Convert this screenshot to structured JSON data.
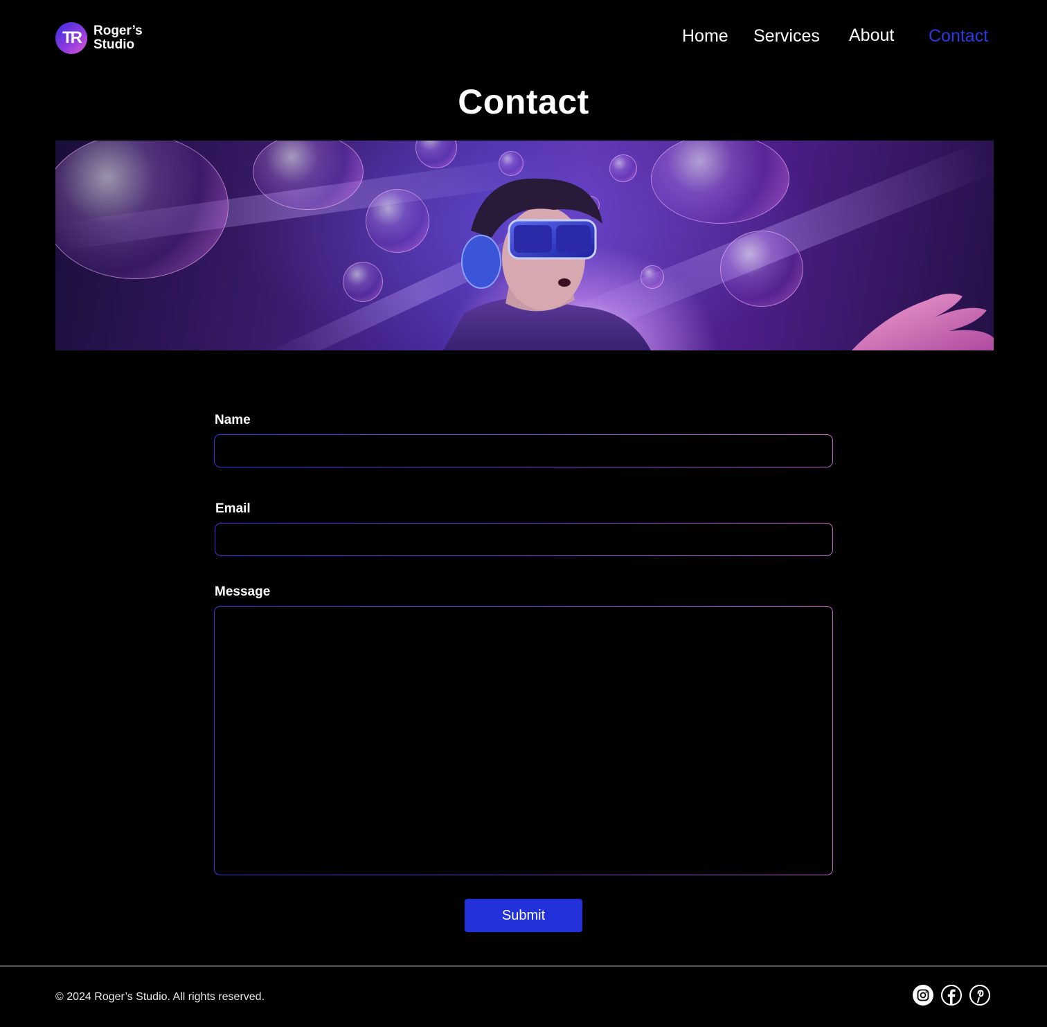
{
  "brand": {
    "logo_initials": "TR",
    "name_line1": "Roger’s",
    "name_line2": "Studio"
  },
  "nav": {
    "items": [
      {
        "label": "Home"
      },
      {
        "label": "Services"
      },
      {
        "label": "About"
      },
      {
        "label": "Contact",
        "active": true
      }
    ],
    "active_color": "#2a3ae0"
  },
  "page": {
    "title": "Contact"
  },
  "hero": {
    "description_icon": "vr-headset-person-banner-image"
  },
  "form": {
    "name_label": "Name",
    "name_value": "",
    "email_label": "Email",
    "email_value": "",
    "message_label": "Message",
    "message_value": "",
    "submit_label": "Submit",
    "submit_color": "#2231da"
  },
  "footer": {
    "copyright": "© 2024 Roger’s Studio. All rights reserved.",
    "social": [
      {
        "icon": "instagram-icon"
      },
      {
        "icon": "facebook-icon"
      },
      {
        "icon": "pinterest-icon"
      }
    ]
  }
}
